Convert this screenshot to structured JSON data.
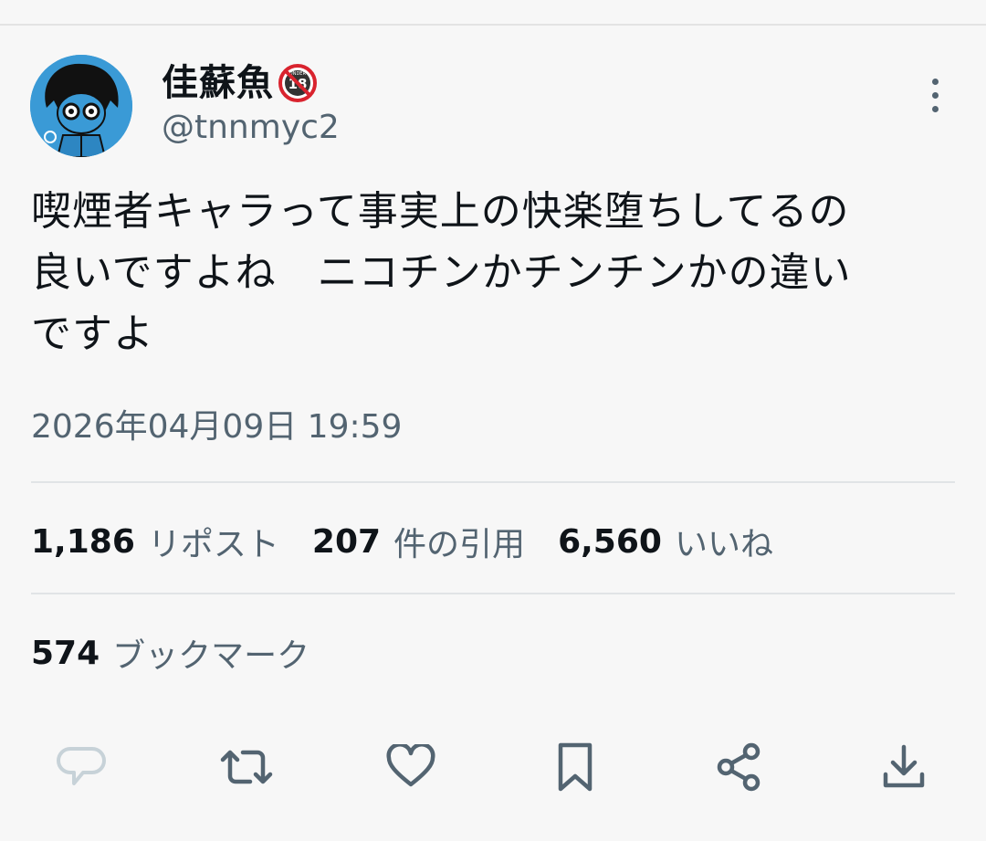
{
  "author": {
    "display_name": "佳蘇魚",
    "handle": "@tnnmyc2",
    "badge_icon": "under-18-prohibited-icon"
  },
  "tweet": {
    "text": "喫煙者キャラって事実上の快楽堕ちしてるの\n良いですよね　ニコチンかチンチンかの違い\nですよ",
    "timestamp": "2026年04月09日 19:59"
  },
  "stats": {
    "reposts": {
      "count": "1,186",
      "label": "リポスト"
    },
    "quotes": {
      "count": "207",
      "label": "件の引用"
    },
    "likes": {
      "count": "6,560",
      "label": "いいね"
    },
    "bookmarks": {
      "count": "574",
      "label": "ブックマーク"
    }
  },
  "actions": [
    {
      "name": "reply",
      "icon": "speech-bubble-icon"
    },
    {
      "name": "repost",
      "icon": "repost-arrows-icon"
    },
    {
      "name": "like",
      "icon": "heart-icon"
    },
    {
      "name": "bookmark",
      "icon": "bookmark-icon"
    },
    {
      "name": "share",
      "icon": "share-icon"
    },
    {
      "name": "download",
      "icon": "download-icon"
    }
  ],
  "colors": {
    "background": "#f7f7f7",
    "text_primary": "#0f1419",
    "text_secondary": "#536471",
    "divider": "#e1e4e6",
    "icon": "#536471",
    "avatar_bg": "#3a9ad6",
    "badge_red": "#d9232e"
  }
}
